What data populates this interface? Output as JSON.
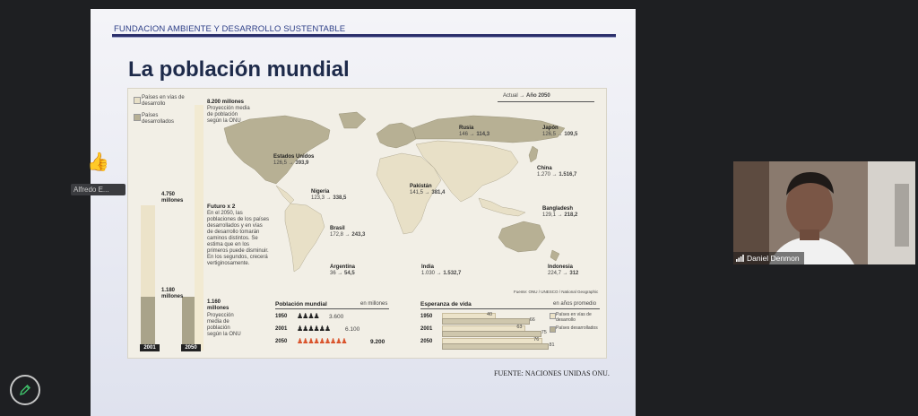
{
  "slide": {
    "org_header": "FUNDACION AMBIENTE Y DESARROLLO SUSTENTABLE",
    "title": "La población mundial",
    "source": "FUENTE: NACIONES UNIDAS ONU."
  },
  "infographic": {
    "legend": {
      "developing": "Países en vías de desarrollo",
      "developed": "Países desarrollados"
    },
    "column_labels": {
      "actual": "Actual",
      "arrow": "→",
      "year": "Año 2050"
    },
    "bars": {
      "total_2050": "8.200 millones",
      "total_2050_note": "Proyección media de población según la ONU",
      "developing_2001": "4.750 millones",
      "developed_2001": "1.180 millones",
      "developed_2050": "1.160 millones",
      "developed_2050_note": "Proyección media de población según la ONU",
      "year_2001": "2001",
      "year_2050": "2050"
    },
    "futuro_title": "Futuro x 2",
    "futuro_text": "En el 2050, las poblaciones de los países desarrollados y en vías de desarrollo tomarán caminos distintos. Se estima que en los primeros puede disminuir. En los segundos, crecerá vertiginosamente.",
    "countries": [
      {
        "name": "Estados Unidos",
        "now": "126,5",
        "future": "393,9"
      },
      {
        "name": "Nigeria",
        "now": "123,3",
        "future": "338,5"
      },
      {
        "name": "Brasil",
        "now": "172,8",
        "future": "243,3"
      },
      {
        "name": "Argentina",
        "now": "36",
        "future": "54,5"
      },
      {
        "name": "Rusia",
        "now": "146",
        "future": "114,3"
      },
      {
        "name": "Pakistán",
        "now": "141,5",
        "future": "381,4"
      },
      {
        "name": "India",
        "now": "1.030",
        "future": "1.532,7"
      },
      {
        "name": "Japón",
        "now": "126,5",
        "future": "109,5"
      },
      {
        "name": "China",
        "now": "1.270",
        "future": "1.516,7"
      },
      {
        "name": "Bangladesh",
        "now": "129,1",
        "future": "218,2"
      },
      {
        "name": "Indonesia",
        "now": "224,7",
        "future": "312"
      }
    ],
    "credit": "Fuente: ONU / UNESCO / National Geographic",
    "pop_block": {
      "title": "Población mundial",
      "unit": "en millones",
      "rows": [
        {
          "year": "1950",
          "value": "3.600"
        },
        {
          "year": "2001",
          "value": "6.100"
        },
        {
          "year": "2050",
          "value": "9.200"
        }
      ]
    },
    "life_block": {
      "title": "Esperanza de vida",
      "unit": "en años promedio",
      "legend_developing": "Países en vías de desarrollo",
      "legend_developed": "Países desarrollados",
      "rows": [
        {
          "year": "1950",
          "developing": "40",
          "developed": "66",
          "dev_val": 40,
          "dvd_val": 66
        },
        {
          "year": "2001",
          "developing": "63",
          "developed": "75",
          "dev_val": 63,
          "dvd_val": 75
        },
        {
          "year": "2050",
          "developing": "76",
          "developed": "81",
          "dev_val": 76,
          "dvd_val": 81
        }
      ]
    }
  },
  "meeting": {
    "attendee_label": "Alfredo E...",
    "video_name": "Daniel Denmon",
    "icons": [
      "thumbs-up-icon",
      "signal-icon",
      "pencil-icon"
    ]
  }
}
